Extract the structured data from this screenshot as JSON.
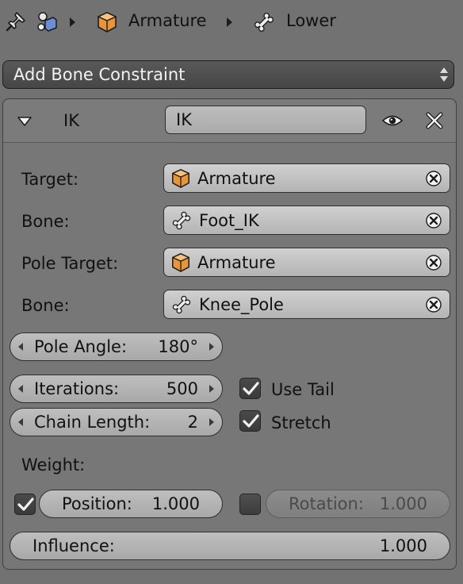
{
  "breadcrumb": {
    "items": [
      {
        "icon": "pin-icon"
      },
      {
        "icon": "scene-objects-icon"
      },
      {
        "icon": "object-cube-icon",
        "label": "Armature"
      },
      {
        "icon": "bone-icon",
        "label": "Lower"
      }
    ]
  },
  "add_menu": {
    "label": "Add Bone Constraint"
  },
  "constraint": {
    "type_label": "IK",
    "name_value": "IK",
    "target_label": "Target:",
    "target_value": "Armature",
    "bone_label": "Bone:",
    "bone_value": "Foot_IK",
    "pole_target_label": "Pole Target:",
    "pole_target_value": "Armature",
    "pole_bone_label": "Bone:",
    "pole_bone_value": "Knee_Pole",
    "pole_angle_label": "Pole Angle:",
    "pole_angle_value": "180°",
    "iterations_label": "Iterations:",
    "iterations_value": "500",
    "chain_length_label": "Chain Length:",
    "chain_length_value": "2",
    "use_tail_label": "Use Tail",
    "use_tail_checked": true,
    "stretch_label": "Stretch",
    "stretch_checked": true,
    "weight_label": "Weight:",
    "position_label": "Position:",
    "position_value": "1.000",
    "position_checked": true,
    "rotation_label": "Rotation:",
    "rotation_value": "1.000",
    "rotation_checked": false,
    "influence_label": "Influence:",
    "influence_value": "1.000"
  },
  "colors": {
    "background": "#727272",
    "object_orange": "#e8953a",
    "checkbox_dark": "#3f3f3f",
    "menu_dark": "#4f4f4f"
  }
}
